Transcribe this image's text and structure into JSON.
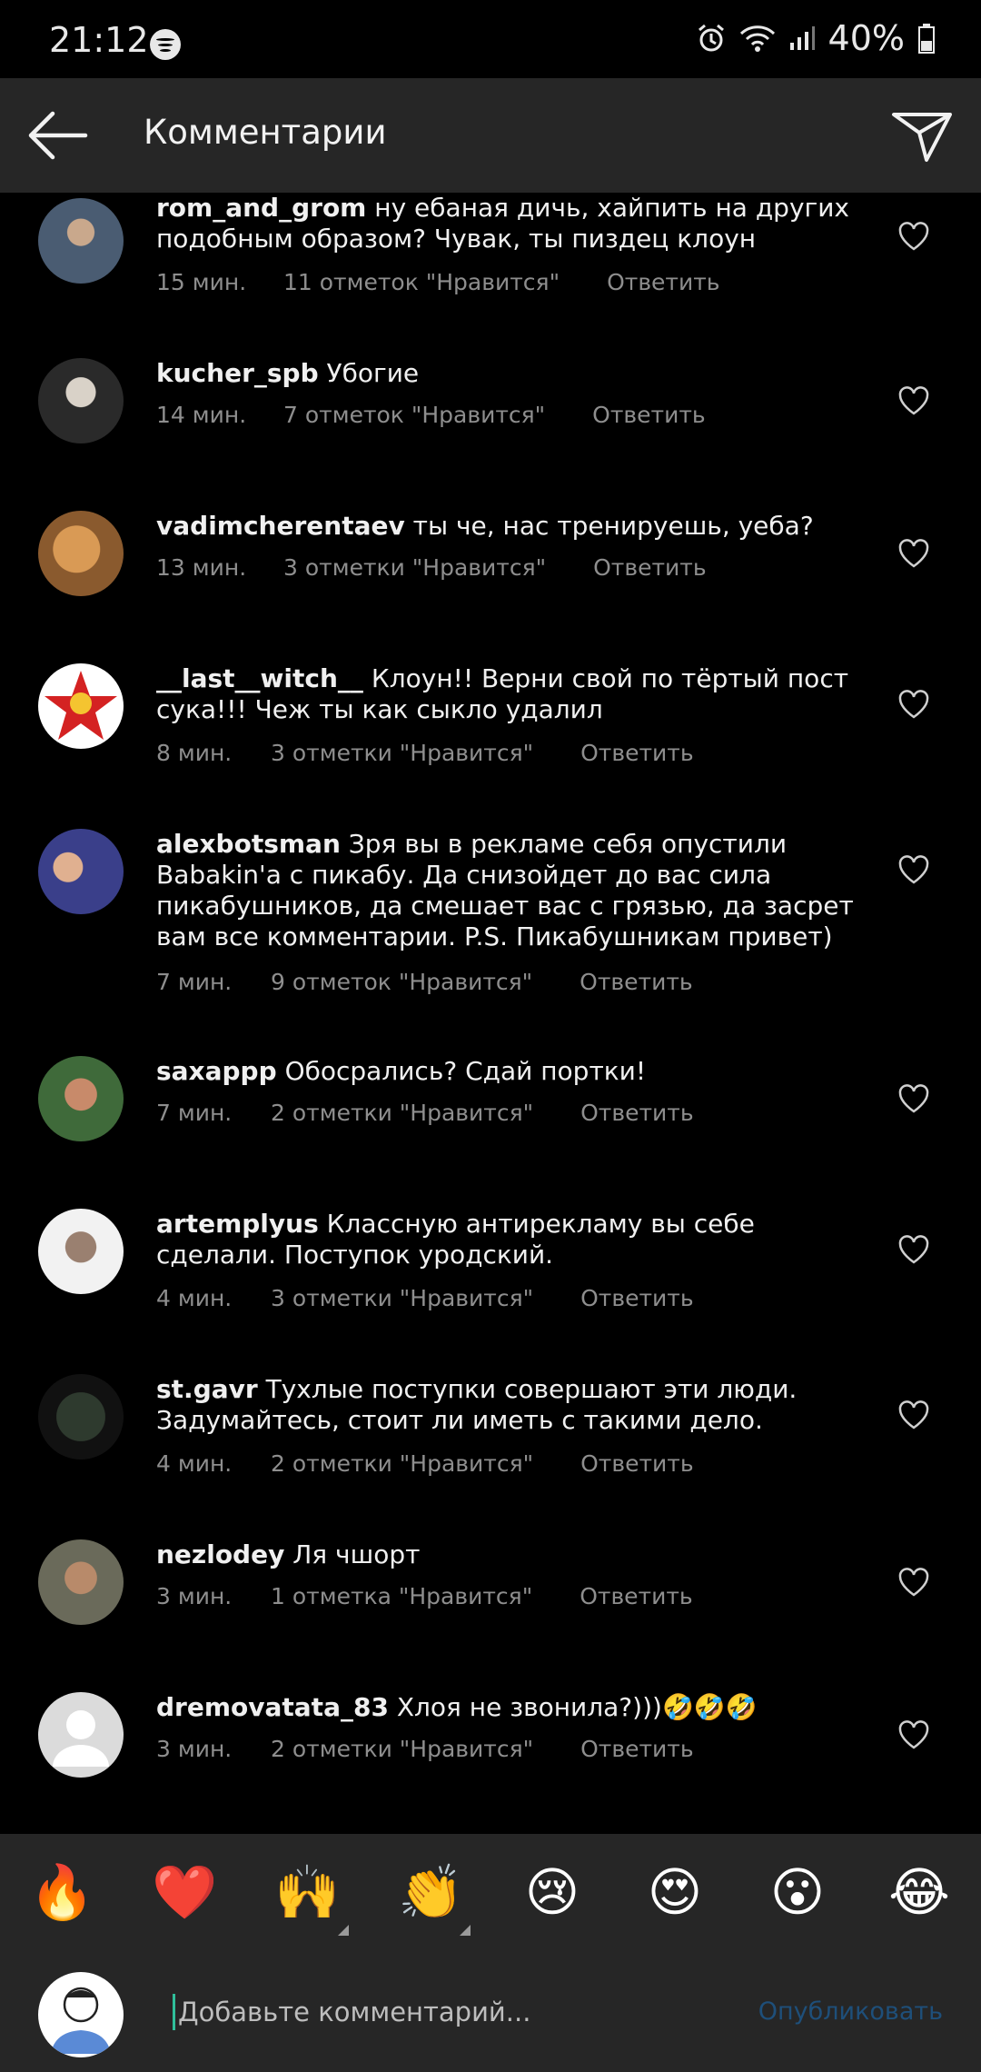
{
  "status_bar": {
    "time": "21:12",
    "battery": "40%"
  },
  "header": {
    "title": "Комментарии",
    "back_icon": "arrow-left-icon",
    "send_icon": "paper-plane-icon"
  },
  "comments": [
    {
      "username": "rom_and_grom",
      "text": "ну ебаная дичь, хайпить на других подобным образом? Чувак, ты пиздец клоун",
      "time": "15 мин.",
      "likes": "11 отметок \"Нравится\"",
      "reply": "Ответить"
    },
    {
      "username": "kucher_spb",
      "text": "Убогие",
      "time": "14 мин.",
      "likes": "7 отметок \"Нравится\"",
      "reply": "Ответить"
    },
    {
      "username": "vadimcherentaev",
      "text": "ты че, нас тренируешь, уеба?",
      "time": "13 мин.",
      "likes": "3 отметки \"Нравится\"",
      "reply": "Ответить"
    },
    {
      "username": "__last__witch__",
      "text": "Клоун!! Верни свой по тёртый пост сука!!! Чеж ты как сыкло удалил",
      "time": "8 мин.",
      "likes": "3 отметки \"Нравится\"",
      "reply": "Ответить"
    },
    {
      "username": "alexbotsman",
      "text": "Зря вы в рекламе себя опустили Babakin'a с пикабу. Да снизойдет до вас сила пикабушников, да смешает вас с грязью, да засрет вам все комментарии. P.S. Пикабушникам привет)",
      "time": "7 мин.",
      "likes": "9 отметок \"Нравится\"",
      "reply": "Ответить"
    },
    {
      "username": "saxappp",
      "text": "Обосрались? Сдай портки!",
      "time": "7 мин.",
      "likes": "2 отметки \"Нравится\"",
      "reply": "Ответить"
    },
    {
      "username": "artemplyus",
      "text": "Классную антирекламу вы себе сделали. Поступок уродский.",
      "time": "4 мин.",
      "likes": "3 отметки \"Нравится\"",
      "reply": "Ответить"
    },
    {
      "username": "st.gavr",
      "text": "Тухлые поступки совершают эти люди. Задумайтесь, стоит ли иметь с такими дело.",
      "time": "4 мин.",
      "likes": "2 отметки \"Нравится\"",
      "reply": "Ответить"
    },
    {
      "username": "nezlodey",
      "text": "Ля чшорт",
      "time": "3 мин.",
      "likes": "1 отметка \"Нравится\"",
      "reply": "Ответить"
    },
    {
      "username": "dremovatata_83",
      "text": "Хлоя не звонила?)))🤣🤣🤣",
      "time": "3 мин.",
      "likes": "2 отметки \"Нравится\"",
      "reply": "Ответить"
    }
  ],
  "emoji_bar": [
    "🔥",
    "❤️",
    "🙌",
    "👏",
    "😢",
    "😍",
    "😮",
    "😂"
  ],
  "composer": {
    "placeholder": "Добавьте комментарий...",
    "publish_label": "Опубликовать"
  },
  "colors": {
    "background": "#000000",
    "bar": "#262626",
    "meta_text": "#8e8e8e",
    "publish": "#1e4f7a"
  }
}
